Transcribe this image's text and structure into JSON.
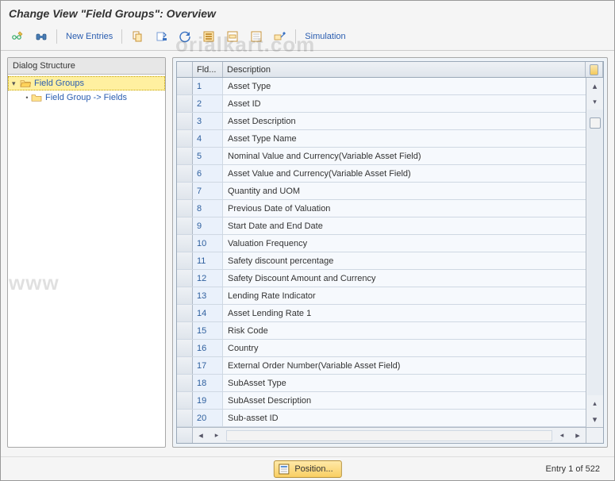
{
  "title": "Change View \"Field Groups\": Overview",
  "toolbar": {
    "new_entries_label": "New Entries",
    "simulation_label": "Simulation"
  },
  "tree": {
    "header": "Dialog Structure",
    "items": [
      {
        "label": "Field Groups",
        "selected": true,
        "level": 0,
        "expandable": true
      },
      {
        "label": "Field Group -> Fields",
        "selected": false,
        "level": 1,
        "expandable": false
      }
    ]
  },
  "table": {
    "col_fld": "Fld...",
    "col_desc": "Description",
    "rows": [
      {
        "fld": "1",
        "desc": "Asset Type"
      },
      {
        "fld": "2",
        "desc": "Asset ID"
      },
      {
        "fld": "3",
        "desc": "Asset Description"
      },
      {
        "fld": "4",
        "desc": "Asset Type Name"
      },
      {
        "fld": "5",
        "desc": "Nominal Value and Currency(Variable Asset Field)"
      },
      {
        "fld": "6",
        "desc": "Asset Value and Currency(Variable Asset Field)"
      },
      {
        "fld": "7",
        "desc": "Quantity and UOM"
      },
      {
        "fld": "8",
        "desc": "Previous Date of Valuation"
      },
      {
        "fld": "9",
        "desc": "Start Date and End Date"
      },
      {
        "fld": "10",
        "desc": "Valuation Frequency"
      },
      {
        "fld": "11",
        "desc": "Safety discount percentage"
      },
      {
        "fld": "12",
        "desc": "Safety Discount Amount and Currency"
      },
      {
        "fld": "13",
        "desc": "Lending Rate Indicator"
      },
      {
        "fld": "14",
        "desc": "Asset Lending Rate 1"
      },
      {
        "fld": "15",
        "desc": "Risk Code"
      },
      {
        "fld": "16",
        "desc": "Country"
      },
      {
        "fld": "17",
        "desc": "External Order Number(Variable Asset Field)"
      },
      {
        "fld": "18",
        "desc": "SubAsset Type"
      },
      {
        "fld": "19",
        "desc": "SubAsset Description"
      },
      {
        "fld": "20",
        "desc": "Sub-asset ID"
      }
    ]
  },
  "footer": {
    "position_label": "Position...",
    "entry_label": "Entry 1 of 522"
  },
  "watermark1": "orialkart.com",
  "watermark2": "www"
}
